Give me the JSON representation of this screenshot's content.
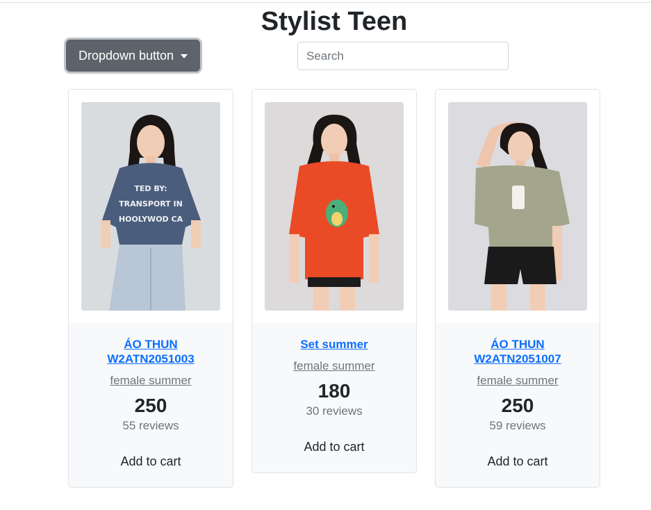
{
  "header": {
    "title": "Stylist Teen",
    "dropdown_label": "Dropdown button",
    "search_placeholder": "Search"
  },
  "products": [
    {
      "name": "ÁO THUN W2ATN2051003",
      "category": "female summer",
      "price": "250",
      "reviews": "55 reviews",
      "cta": "Add to cart",
      "shirt_color": "#4a5d7c",
      "bottom_color": "#b8c6d6",
      "shirt_text": "TED BY: TRANSPORT IN HOOLYWOD CA"
    },
    {
      "name": "Set summer",
      "category": "female summer",
      "price": "180",
      "reviews": "30 reviews",
      "cta": "Add to cart",
      "shirt_color": "#ea4a26",
      "bottom_color": "#1c1c1c",
      "shirt_text": ""
    },
    {
      "name": "ÁO THUN W2ATN2051007",
      "category": "female summer",
      "price": "250",
      "reviews": "59 reviews",
      "cta": "Add to cart",
      "shirt_color": "#a3a68c",
      "bottom_color": "#1a1a1a",
      "shirt_text": ""
    }
  ]
}
